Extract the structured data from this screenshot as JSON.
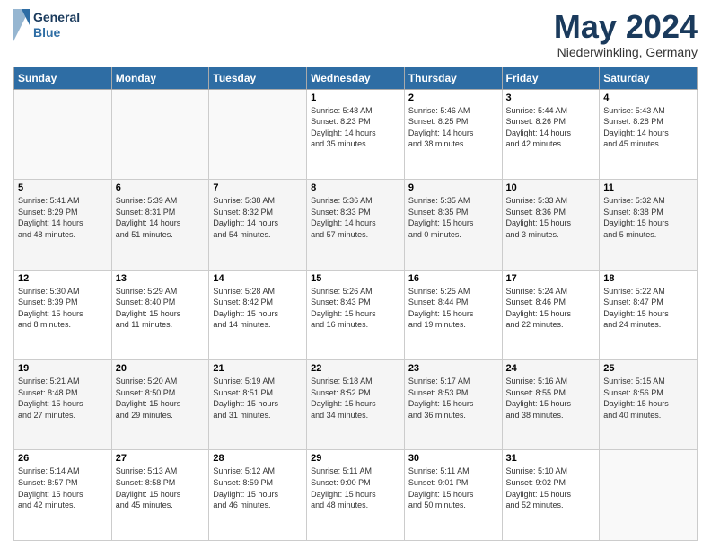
{
  "header": {
    "logo_line1": "General",
    "logo_line2": "Blue",
    "month_title": "May 2024",
    "location": "Niederwinkling, Germany"
  },
  "weekdays": [
    "Sunday",
    "Monday",
    "Tuesday",
    "Wednesday",
    "Thursday",
    "Friday",
    "Saturday"
  ],
  "weeks": [
    [
      {
        "day": "",
        "info": ""
      },
      {
        "day": "",
        "info": ""
      },
      {
        "day": "",
        "info": ""
      },
      {
        "day": "1",
        "info": "Sunrise: 5:48 AM\nSunset: 8:23 PM\nDaylight: 14 hours\nand 35 minutes."
      },
      {
        "day": "2",
        "info": "Sunrise: 5:46 AM\nSunset: 8:25 PM\nDaylight: 14 hours\nand 38 minutes."
      },
      {
        "day": "3",
        "info": "Sunrise: 5:44 AM\nSunset: 8:26 PM\nDaylight: 14 hours\nand 42 minutes."
      },
      {
        "day": "4",
        "info": "Sunrise: 5:43 AM\nSunset: 8:28 PM\nDaylight: 14 hours\nand 45 minutes."
      }
    ],
    [
      {
        "day": "5",
        "info": "Sunrise: 5:41 AM\nSunset: 8:29 PM\nDaylight: 14 hours\nand 48 minutes."
      },
      {
        "day": "6",
        "info": "Sunrise: 5:39 AM\nSunset: 8:31 PM\nDaylight: 14 hours\nand 51 minutes."
      },
      {
        "day": "7",
        "info": "Sunrise: 5:38 AM\nSunset: 8:32 PM\nDaylight: 14 hours\nand 54 minutes."
      },
      {
        "day": "8",
        "info": "Sunrise: 5:36 AM\nSunset: 8:33 PM\nDaylight: 14 hours\nand 57 minutes."
      },
      {
        "day": "9",
        "info": "Sunrise: 5:35 AM\nSunset: 8:35 PM\nDaylight: 15 hours\nand 0 minutes."
      },
      {
        "day": "10",
        "info": "Sunrise: 5:33 AM\nSunset: 8:36 PM\nDaylight: 15 hours\nand 3 minutes."
      },
      {
        "day": "11",
        "info": "Sunrise: 5:32 AM\nSunset: 8:38 PM\nDaylight: 15 hours\nand 5 minutes."
      }
    ],
    [
      {
        "day": "12",
        "info": "Sunrise: 5:30 AM\nSunset: 8:39 PM\nDaylight: 15 hours\nand 8 minutes."
      },
      {
        "day": "13",
        "info": "Sunrise: 5:29 AM\nSunset: 8:40 PM\nDaylight: 15 hours\nand 11 minutes."
      },
      {
        "day": "14",
        "info": "Sunrise: 5:28 AM\nSunset: 8:42 PM\nDaylight: 15 hours\nand 14 minutes."
      },
      {
        "day": "15",
        "info": "Sunrise: 5:26 AM\nSunset: 8:43 PM\nDaylight: 15 hours\nand 16 minutes."
      },
      {
        "day": "16",
        "info": "Sunrise: 5:25 AM\nSunset: 8:44 PM\nDaylight: 15 hours\nand 19 minutes."
      },
      {
        "day": "17",
        "info": "Sunrise: 5:24 AM\nSunset: 8:46 PM\nDaylight: 15 hours\nand 22 minutes."
      },
      {
        "day": "18",
        "info": "Sunrise: 5:22 AM\nSunset: 8:47 PM\nDaylight: 15 hours\nand 24 minutes."
      }
    ],
    [
      {
        "day": "19",
        "info": "Sunrise: 5:21 AM\nSunset: 8:48 PM\nDaylight: 15 hours\nand 27 minutes."
      },
      {
        "day": "20",
        "info": "Sunrise: 5:20 AM\nSunset: 8:50 PM\nDaylight: 15 hours\nand 29 minutes."
      },
      {
        "day": "21",
        "info": "Sunrise: 5:19 AM\nSunset: 8:51 PM\nDaylight: 15 hours\nand 31 minutes."
      },
      {
        "day": "22",
        "info": "Sunrise: 5:18 AM\nSunset: 8:52 PM\nDaylight: 15 hours\nand 34 minutes."
      },
      {
        "day": "23",
        "info": "Sunrise: 5:17 AM\nSunset: 8:53 PM\nDaylight: 15 hours\nand 36 minutes."
      },
      {
        "day": "24",
        "info": "Sunrise: 5:16 AM\nSunset: 8:55 PM\nDaylight: 15 hours\nand 38 minutes."
      },
      {
        "day": "25",
        "info": "Sunrise: 5:15 AM\nSunset: 8:56 PM\nDaylight: 15 hours\nand 40 minutes."
      }
    ],
    [
      {
        "day": "26",
        "info": "Sunrise: 5:14 AM\nSunset: 8:57 PM\nDaylight: 15 hours\nand 42 minutes."
      },
      {
        "day": "27",
        "info": "Sunrise: 5:13 AM\nSunset: 8:58 PM\nDaylight: 15 hours\nand 45 minutes."
      },
      {
        "day": "28",
        "info": "Sunrise: 5:12 AM\nSunset: 8:59 PM\nDaylight: 15 hours\nand 46 minutes."
      },
      {
        "day": "29",
        "info": "Sunrise: 5:11 AM\nSunset: 9:00 PM\nDaylight: 15 hours\nand 48 minutes."
      },
      {
        "day": "30",
        "info": "Sunrise: 5:11 AM\nSunset: 9:01 PM\nDaylight: 15 hours\nand 50 minutes."
      },
      {
        "day": "31",
        "info": "Sunrise: 5:10 AM\nSunset: 9:02 PM\nDaylight: 15 hours\nand 52 minutes."
      },
      {
        "day": "",
        "info": ""
      }
    ]
  ]
}
